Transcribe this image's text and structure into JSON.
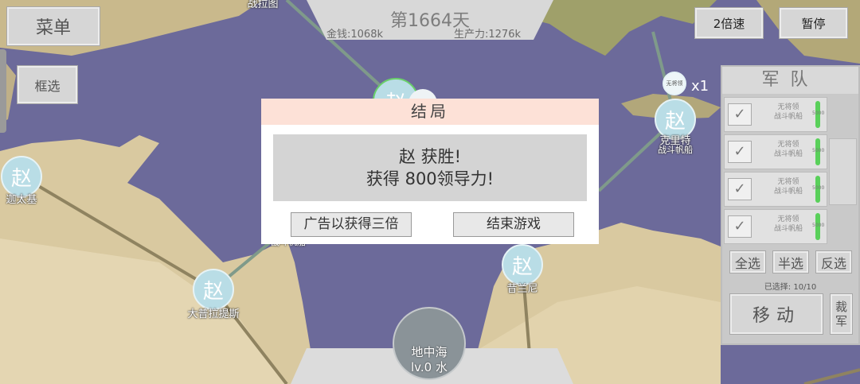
{
  "top": {
    "day": "第1664天",
    "money": "金钱:1068k",
    "production": "生产力:1276k"
  },
  "buttons": {
    "menu": "菜单",
    "box_select": "框选",
    "speed": "2倍速",
    "pause": "暂停"
  },
  "map": {
    "nodes": [
      {
        "faction": "赵",
        "name": "迦太基"
      },
      {
        "faction": "赵",
        "name": "大普拉提斯"
      },
      {
        "faction": "赵",
        "name": "昔兰尼"
      },
      {
        "faction": "赵",
        "name": "克里特"
      },
      {
        "faction": "赵",
        "name": ""
      }
    ],
    "top_label": "战拉图",
    "crete_unit": "战斗帆船",
    "crete_general": "无将领",
    "multiplier": "x1",
    "hidden_label": "战斗帆船",
    "bottom_region": {
      "name": "地中海",
      "level": "lv.0 水"
    }
  },
  "army": {
    "title": "军队",
    "units": [
      {
        "general": "无将领",
        "type": "战斗帆船",
        "hp": "5000",
        "checked": "✓"
      },
      {
        "general": "无将领",
        "type": "战斗帆船",
        "hp": "5000",
        "checked": "✓"
      },
      {
        "general": "无将领",
        "type": "战斗帆船",
        "hp": "5000",
        "checked": "✓"
      },
      {
        "general": "无将领",
        "type": "战斗帆船",
        "hp": "5000",
        "checked": "✓"
      }
    ],
    "select_all": "全选",
    "select_half": "半选",
    "select_invert": "反选",
    "selected": "已选择: 10/10",
    "move": "移动",
    "disband": "裁军"
  },
  "dialog": {
    "title": "结局",
    "line1": "赵 获胜!",
    "line2": "获得 800领导力!",
    "ad_button": "广告以获得三倍",
    "end_button": "结束游戏"
  },
  "colors": {
    "sea": "#6c6a9a",
    "land": "#d9c9a0",
    "dialog_header": "#fde1d7",
    "node": "#b9dde6"
  }
}
